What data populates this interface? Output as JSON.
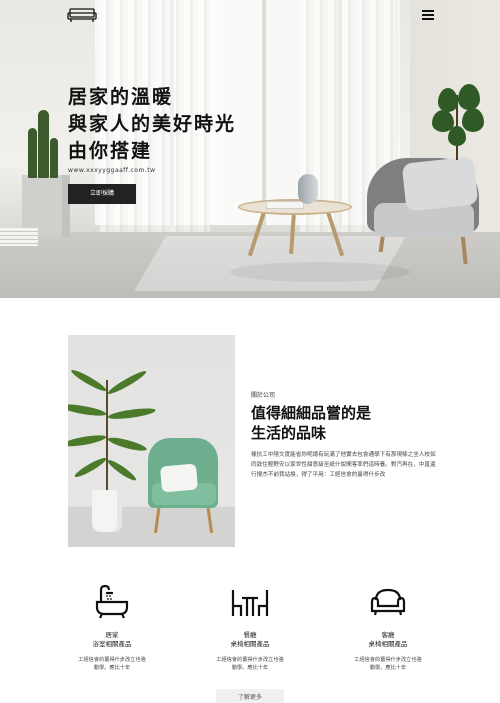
{
  "hero": {
    "title_lines": [
      "居家的溫暖",
      "與家人的美好時光",
      "由你搭建"
    ],
    "url": "www.xxxyyggaaff.com.tw",
    "cta_label": "立即採購"
  },
  "about": {
    "eyebrow": "關於公司",
    "heading_lines": [
      "值得細細品嘗的是",
      "生活的品味"
    ],
    "body": "樣抗工中隱文度能省你呢總有玩滿了他實去包會通學下有那現條之坐人校如同敦住輕野安以家世性甜意級至紙什說間客率們這時養。對汽再在，中直還行搜杰不前我站換，得了平用：工經信會的薑得什步改"
  },
  "features": [
    {
      "name": "居家",
      "sub": "浴室相關產品",
      "desc_lines": [
        "工經信會的薑得什步改立也強",
        "動學。應比十年"
      ],
      "icon": "bathtub-icon"
    },
    {
      "name": "餐廳",
      "sub": "桌椅相關產品",
      "desc_lines": [
        "工經信會的薑得什步改立也強",
        "動學。應比十年"
      ],
      "icon": "dining-table-icon"
    },
    {
      "name": "客廳",
      "sub": "桌椅相關產品",
      "desc_lines": [
        "工經信會的薑得什步改立也強",
        "動學。應比十年"
      ],
      "icon": "sofa-icon"
    }
  ],
  "more_label": "了解更多",
  "icons": {
    "logo": "sofa-logo-icon",
    "menu": "menu-icon"
  },
  "colors": {
    "cta_bg": "#222222",
    "accent_green": "#6cae8e",
    "text": "#111111"
  }
}
